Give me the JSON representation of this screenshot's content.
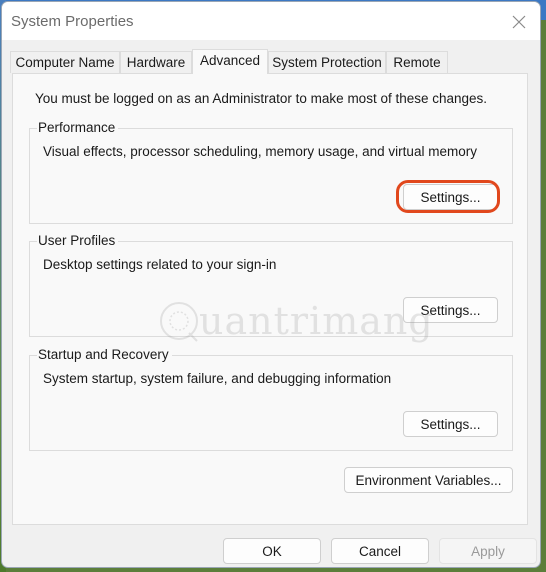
{
  "window": {
    "title": "System Properties"
  },
  "tabs": [
    {
      "label": "Computer Name",
      "active": false
    },
    {
      "label": "Hardware",
      "active": false
    },
    {
      "label": "Advanced",
      "active": true
    },
    {
      "label": "System Protection",
      "active": false
    },
    {
      "label": "Remote",
      "active": false
    }
  ],
  "advanced": {
    "admin_note": "You must be logged on as an Administrator to make most of these changes.",
    "groups": [
      {
        "label": "Performance",
        "description": "Visual effects, processor scheduling, memory usage, and virtual memory",
        "button": "Settings...",
        "highlighted": true
      },
      {
        "label": "User Profiles",
        "description": "Desktop settings related to your sign-in",
        "button": "Settings...",
        "highlighted": false
      },
      {
        "label": "Startup and Recovery",
        "description": "System startup, system failure, and debugging information",
        "button": "Settings...",
        "highlighted": false
      }
    ],
    "env_button": "Environment Variables..."
  },
  "footer": {
    "ok": "OK",
    "cancel": "Cancel",
    "apply": "Apply",
    "apply_enabled": false
  },
  "watermark": {
    "text": "uantrimang",
    "icon": "lightbulb-q-icon"
  },
  "colors": {
    "highlight": "#e1481d"
  }
}
